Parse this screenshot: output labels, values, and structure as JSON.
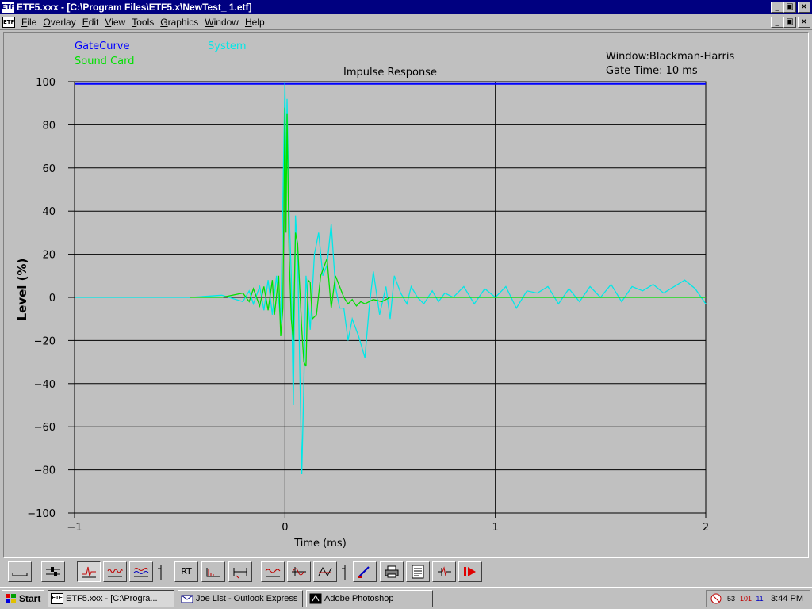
{
  "window": {
    "app_icon": "ETF",
    "title": "ETF5.xxx - [C:\\Program Files\\ETF5.x\\NewTest_ 1.etf]",
    "minimize": "_",
    "restore": "▣",
    "close": "×"
  },
  "menu": {
    "doc_icon": "ETF",
    "items": [
      "File",
      "Overlay",
      "Edit",
      "View",
      "Tools",
      "Graphics",
      "Window",
      "Help"
    ],
    "underline": [
      "F",
      "O",
      "E",
      "V",
      "T",
      "G",
      "W",
      "H"
    ]
  },
  "legend": {
    "gate_curve": "GateCurve",
    "sound_card": "Sound Card",
    "system": "System",
    "window_info": "Window:Blackman-Harris",
    "gate_time": "Gate Time: 10 ms"
  },
  "colors": {
    "gate_curve": "#0000ff",
    "sound_card": "#00e000",
    "system": "#00e8e8",
    "plot_bg": "#c0c0c0",
    "grid": "#000000"
  },
  "chart_data": {
    "type": "line",
    "title": "Impulse Response",
    "xlabel": "Time (ms)",
    "ylabel": "Level (%)",
    "xlim": [
      -1,
      2
    ],
    "ylim": [
      -100,
      100
    ],
    "xticks": [
      -1,
      0,
      1,
      2
    ],
    "xtick_labels": [
      "−1",
      "0",
      "1",
      "2"
    ],
    "yticks": [
      100,
      80,
      60,
      40,
      20,
      0,
      -20,
      -40,
      -60,
      -80,
      -100
    ],
    "ytick_labels": [
      "100",
      "80",
      "60",
      "40",
      "20",
      "0",
      "−20",
      "−40",
      "−60",
      "−80",
      "−100"
    ],
    "grid": true,
    "series": [
      {
        "name": "GateCurve",
        "x": [
          -1,
          2
        ],
        "y": [
          99,
          99
        ]
      },
      {
        "name": "Sound Card",
        "x": [
          -0.45,
          -0.3,
          -0.2,
          -0.17,
          -0.15,
          -0.12,
          -0.1,
          -0.08,
          -0.06,
          -0.05,
          -0.03,
          -0.02,
          -0.01,
          0.0,
          0.005,
          0.01,
          0.02,
          0.03,
          0.04,
          0.05,
          0.06,
          0.07,
          0.08,
          0.09,
          0.1,
          0.11,
          0.12,
          0.13,
          0.15,
          0.17,
          0.2,
          0.22,
          0.24,
          0.26,
          0.28,
          0.3,
          0.32,
          0.34,
          0.36,
          0.38,
          0.42,
          0.46,
          0.5,
          0.55,
          0.6,
          0.7,
          1.0,
          2.0
        ],
        "y": [
          0,
          0,
          2,
          -2,
          4,
          -4,
          5,
          -6,
          8,
          -8,
          10,
          -18,
          -5,
          88,
          30,
          85,
          20,
          -10,
          -20,
          30,
          25,
          5,
          -15,
          -30,
          -32,
          8,
          7,
          -10,
          -8,
          10,
          18,
          -5,
          10,
          5,
          0,
          -3,
          -1,
          -4,
          -2,
          -3,
          -1,
          -2,
          0,
          0,
          0,
          0,
          0,
          0
        ]
      },
      {
        "name": "System",
        "x": [
          -1,
          -0.45,
          -0.3,
          -0.2,
          -0.17,
          -0.15,
          -0.12,
          -0.1,
          -0.08,
          -0.06,
          -0.04,
          -0.02,
          0.0,
          0.005,
          0.01,
          0.02,
          0.03,
          0.04,
          0.05,
          0.06,
          0.07,
          0.08,
          0.09,
          0.1,
          0.12,
          0.14,
          0.16,
          0.18,
          0.2,
          0.22,
          0.24,
          0.26,
          0.28,
          0.3,
          0.32,
          0.35,
          0.38,
          0.4,
          0.42,
          0.45,
          0.48,
          0.5,
          0.52,
          0.55,
          0.58,
          0.6,
          0.63,
          0.66,
          0.7,
          0.73,
          0.76,
          0.8,
          0.85,
          0.9,
          0.95,
          1.0,
          1.05,
          1.1,
          1.15,
          1.2,
          1.25,
          1.3,
          1.35,
          1.4,
          1.45,
          1.5,
          1.55,
          1.6,
          1.65,
          1.7,
          1.75,
          1.8,
          1.85,
          1.9,
          1.95,
          2.0
        ],
        "y": [
          0,
          0,
          1,
          -2,
          3,
          -3,
          5,
          -6,
          8,
          -8,
          10,
          -12,
          100,
          50,
          92,
          40,
          10,
          -50,
          38,
          20,
          -30,
          -82,
          -40,
          10,
          -15,
          20,
          30,
          10,
          15,
          34,
          5,
          -5,
          -5,
          -20,
          -10,
          -18,
          -28,
          -5,
          12,
          -8,
          5,
          -10,
          10,
          2,
          -3,
          5,
          0,
          -3,
          3,
          -2,
          2,
          0,
          5,
          -3,
          4,
          0,
          5,
          -5,
          3,
          2,
          5,
          -3,
          4,
          -2,
          5,
          0,
          6,
          -2,
          5,
          3,
          6,
          2,
          5,
          8,
          4,
          -3
        ]
      }
    ]
  },
  "toolbar": {
    "rt_label": "RT"
  },
  "taskbar": {
    "start": "Start",
    "tasks": [
      {
        "label": "ETF5.xxx - [C:\\Progra...",
        "icon": "ETF"
      },
      {
        "label": "Joe List - Outlook Express",
        "icon": ""
      },
      {
        "label": "Adobe Photoshop",
        "icon": ""
      }
    ],
    "tray_icons": [
      "53",
      "101",
      "11"
    ],
    "clock": "3:44 PM"
  }
}
